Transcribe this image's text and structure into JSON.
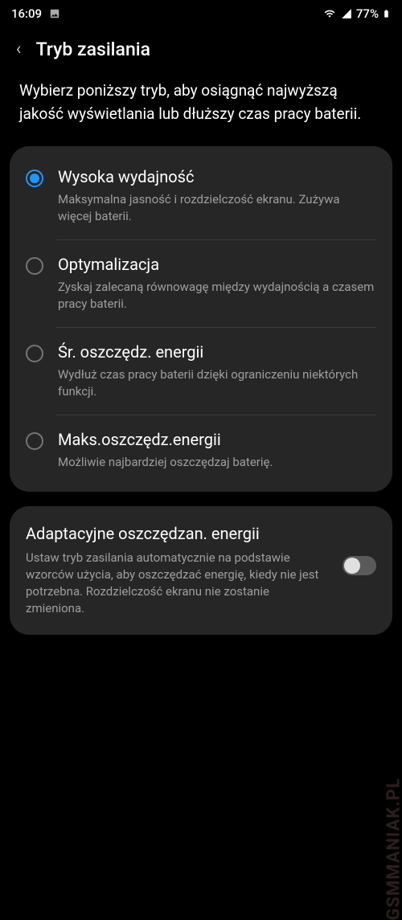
{
  "status_bar": {
    "time": "16:09",
    "battery_percent": "77%"
  },
  "header": {
    "title": "Tryb zasilania"
  },
  "description": "Wybierz poniższy tryb, aby osiągnąć najwyższą jakość wyświetlania lub dłuższy czas pracy baterii.",
  "options": [
    {
      "title": "Wysoka wydajność",
      "desc": "Maksymalna jasność i rozdzielczość ekranu. Zużywa więcej baterii.",
      "selected": true
    },
    {
      "title": "Optymalizacja",
      "desc": "Zyskaj zalecaną równowagę między wydajnością a czasem pracy baterii.",
      "selected": false
    },
    {
      "title": "Śr. oszczędz. energii",
      "desc": "Wydłuż czas pracy baterii dzięki ograniczeniu niektórych funkcji.",
      "selected": false
    },
    {
      "title": "Maks.oszczędz.energii",
      "desc": "Możliwie najbardziej oszczędzaj baterię.",
      "selected": false
    }
  ],
  "adaptive": {
    "title": "Adaptacyjne oszczędzan. energii",
    "desc": "Ustaw tryb zasilania automatycznie na podstawie wzorców użycia, aby oszczędzać energię, kiedy nie jest potrzebna. Rozdzielczość ekranu nie zostanie zmieniona.",
    "enabled": false
  },
  "watermark": "GSMMANIAK.PL"
}
